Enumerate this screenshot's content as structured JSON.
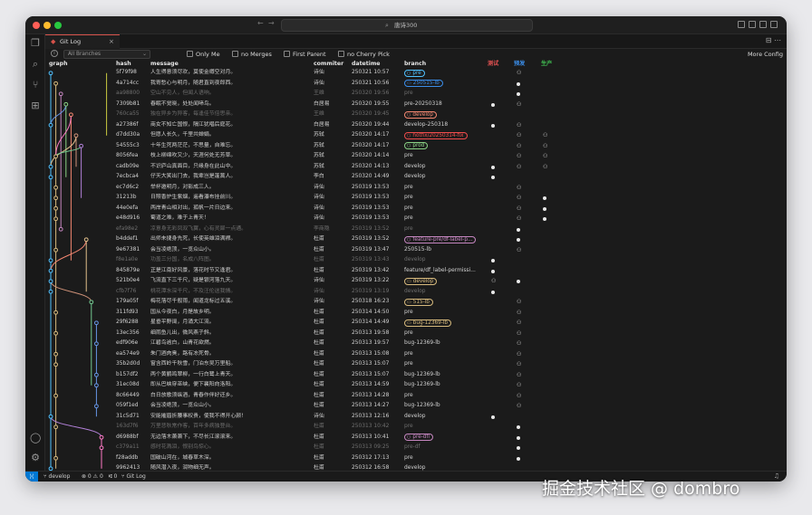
{
  "window": {
    "search_text": "唐诗300"
  },
  "tab": {
    "label": "Git Log",
    "close": "×"
  },
  "toolbar": {
    "branch_placeholder": "All Branches",
    "only_me": "Only Me",
    "no_merges": "no Merges",
    "first_parent": "First Parent",
    "no_cherry_pick": "no Cherry Pick",
    "more_config": "More Config"
  },
  "headers": {
    "graph": "graph",
    "hash": "hash",
    "message": "message",
    "committer": "commiter",
    "datetime": "datetime",
    "branch": "branch",
    "env_test": "测试",
    "env_pre": "预发",
    "env_prod": "生产"
  },
  "colors": {
    "env_test": "#e05151",
    "env_pre": "#3b8eea",
    "env_prod": "#3fb950",
    "graph": [
      "#4fc1ff",
      "#d7ba7d",
      "#c586c0",
      "#89d185",
      "#f48771",
      "#ce9178",
      "#b180d7",
      "#e2c08d",
      "#73c991",
      "#6796e6",
      "#ff79c6",
      "#cbcb41"
    ]
  },
  "commits": [
    {
      "hash": "5f79f98",
      "msg": "人生得意须尽欢，莫使金樽空对月。",
      "who": "诗仙",
      "date": "250321 10:57",
      "branch": "pre",
      "badge": "pre",
      "bcolor": "#4fc1ff",
      "test": "",
      "pre": "person",
      "prod": "",
      "dim": false
    },
    {
      "hash": "4a714cc",
      "msg": "我寄愁心与明月，随君直到夜郎西。",
      "who": "诗仙",
      "date": "250321 10:56",
      "branch": "250515-lb",
      "badge": "tag",
      "bcolor": "#3b8eea",
      "test": "",
      "pre": "dot",
      "prod": "",
      "dim": false
    },
    {
      "hash": "aa98800",
      "msg": "空山不见人，但闻人语响。",
      "who": "王维",
      "date": "250320 19:56",
      "branch": "pre",
      "badge": "",
      "bcolor": "",
      "test": "",
      "pre": "dot",
      "prod": "",
      "dim": true
    },
    {
      "hash": "7309b81",
      "msg": "春眠不觉晓，处处闻啼鸟。",
      "who": "白居易",
      "date": "250320 19:55",
      "branch": "pre-20250318",
      "badge": "",
      "bcolor": "",
      "test": "dot",
      "pre": "person",
      "prod": "",
      "dim": false
    },
    {
      "hash": "760ca55",
      "msg": "独在异乡为异客，每逢佳节倍思亲。",
      "who": "王维",
      "date": "250320 19:45",
      "branch": "develop",
      "badge": "branch",
      "bcolor": "#f48771",
      "test": "",
      "pre": "",
      "prod": "",
      "dim": true
    },
    {
      "hash": "a27386f",
      "msg": "商女不知亡国恨，隔江犹唱后庭花。",
      "who": "白居易",
      "date": "250320 19:44",
      "branch": "develop-250318",
      "badge": "",
      "bcolor": "",
      "test": "dot",
      "pre": "person",
      "prod": "",
      "dim": false
    },
    {
      "hash": "d7dd30a",
      "msg": "但愿人长久，千里共婵娟。",
      "who": "苏轼",
      "date": "250320 14:17",
      "branch": "hotfix/20250314-fix",
      "badge": "branch",
      "bcolor": "#f14c4c",
      "test": "",
      "pre": "person",
      "prod": "person",
      "dim": false
    },
    {
      "hash": "54555c3",
      "msg": "十年生死两茫茫，不思量，自难忘。",
      "who": "苏轼",
      "date": "250320 14:17",
      "branch": "prod",
      "badge": "branch",
      "bcolor": "#89d185",
      "test": "",
      "pre": "person",
      "prod": "person",
      "dim": false
    },
    {
      "hash": "8056fea",
      "msg": "枝上柳绵吹又少，天涯何处无芳草。",
      "who": "苏轼",
      "date": "250320 14:14",
      "branch": "pre",
      "badge": "",
      "bcolor": "",
      "test": "",
      "pre": "person",
      "prod": "person",
      "dim": false
    },
    {
      "hash": "cadb09e",
      "msg": "不识庐山真面目，只缘身在此山中。",
      "who": "苏轼",
      "date": "250320 14:13",
      "branch": "develop",
      "badge": "",
      "bcolor": "",
      "test": "dot",
      "pre": "person",
      "prod": "person",
      "dim": false
    },
    {
      "hash": "7ecbca4",
      "msg": "仔天大笑出门去，我辈岂是蓬蒿人。",
      "who": "李白",
      "date": "250320 14:49",
      "branch": "develop",
      "badge": "",
      "bcolor": "",
      "test": "dot",
      "pre": "",
      "prod": "",
      "dim": false
    },
    {
      "hash": "ec7d6c2",
      "msg": "举杯邀明月，对影成三人。",
      "who": "诗仙",
      "date": "250319 13:53",
      "branch": "pre",
      "badge": "",
      "bcolor": "",
      "test": "",
      "pre": "person",
      "prod": "",
      "dim": false
    },
    {
      "hash": "31213b",
      "msg": "日照香炉生紫烟，遥看瀑布挂前川。",
      "who": "诗仙",
      "date": "250319 13:53",
      "branch": "pre",
      "badge": "",
      "bcolor": "",
      "test": "",
      "pre": "person",
      "prod": "dot",
      "dim": false
    },
    {
      "hash": "44e0efa",
      "msg": "两岸青山相对出，孤帆一片日边来。",
      "who": "诗仙",
      "date": "250319 13:53",
      "branch": "pre",
      "badge": "",
      "bcolor": "",
      "test": "",
      "pre": "person",
      "prod": "dot",
      "dim": false
    },
    {
      "hash": "e48d916",
      "msg": "蜀道之难，难于上青天！",
      "who": "诗仙",
      "date": "250319 13:53",
      "branch": "pre",
      "badge": "",
      "bcolor": "",
      "test": "",
      "pre": "person",
      "prod": "dot",
      "dim": false
    },
    {
      "hash": "efa98e2",
      "msg": "凉意身无彩凤双飞翼，心有灵犀一点通。",
      "who": "李商隐",
      "date": "250319 13:52",
      "branch": "pre",
      "badge": "",
      "bcolor": "",
      "test": "",
      "pre": "dot",
      "prod": "",
      "dim": true
    },
    {
      "hash": "b4ddef1",
      "msg": "出师未捷身先死，长使英雄泪满襟。",
      "who": "杜甫",
      "date": "250319 13:52",
      "branch": "feature-pre/df-label-p...",
      "badge": "branch",
      "bcolor": "#c586c0",
      "test": "",
      "pre": "dot",
      "prod": "",
      "dim": false
    },
    {
      "hash": "9e67381",
      "msg": "会当凌绝顶，一览众山小。",
      "who": "杜甫",
      "date": "250319 13:47",
      "branch": "250515-lb",
      "badge": "",
      "bcolor": "",
      "test": "",
      "pre": "person",
      "prod": "",
      "dim": false
    },
    {
      "hash": "f8e1a0e",
      "msg": "功盖三分国，名成八阵图。",
      "who": "杜甫",
      "date": "250319 13:43",
      "branch": "develop",
      "badge": "",
      "bcolor": "",
      "test": "dot",
      "pre": "",
      "prod": "",
      "dim": true
    },
    {
      "hash": "845879e",
      "msg": "正是江南好风景，落花时节又逢君。",
      "who": "杜甫",
      "date": "250319 13:42",
      "branch": "feature/df_label-permissi...",
      "badge": "",
      "bcolor": "",
      "test": "dot",
      "pre": "",
      "prod": "",
      "dim": false
    },
    {
      "hash": "521b0e4",
      "msg": "飞流直下三千尺，疑是银河落九天。",
      "who": "诗仙",
      "date": "250319 13:22",
      "branch": "develop",
      "badge": "tag",
      "bcolor": "#d7ba7d",
      "test": "person",
      "pre": "dot",
      "prod": "",
      "dim": false
    },
    {
      "hash": "cfb7f76",
      "msg": "桃花潭水深千尺，不及汪伦送我情。",
      "who": "诗仙",
      "date": "250319 13:19",
      "branch": "develop",
      "badge": "",
      "bcolor": "",
      "test": "dot",
      "pre": "",
      "prod": "",
      "dim": true
    },
    {
      "hash": "179a05f",
      "msg": "梅花落尽千般雨，闻道龙标过五溪。",
      "who": "诗仙",
      "date": "250318 16:23",
      "branch": "515-lb",
      "badge": "tag",
      "bcolor": "#d7ba7d",
      "test": "",
      "pre": "person",
      "prod": "",
      "dim": false
    },
    {
      "hash": "311fd93",
      "msg": "国从今夜白，月是故乡明。",
      "who": "杜甫",
      "date": "250314 14:50",
      "branch": "pre",
      "badge": "",
      "bcolor": "",
      "test": "",
      "pre": "person",
      "prod": "",
      "dim": false
    },
    {
      "hash": "29f6288",
      "msg": "星垂平野阔，月涌大江流。",
      "who": "杜甫",
      "date": "250314 14:49",
      "branch": "bug-12369-lb",
      "badge": "tag",
      "bcolor": "#d7ba7d",
      "test": "",
      "pre": "person",
      "prod": "",
      "dim": false
    },
    {
      "hash": "13ec356",
      "msg": "细雨鱼儿出，微风燕子斜。",
      "who": "杜甫",
      "date": "250313 19:58",
      "branch": "pre",
      "badge": "",
      "bcolor": "",
      "test": "",
      "pre": "person",
      "prod": "",
      "dim": false
    },
    {
      "hash": "edf906e",
      "msg": "江碧鸟逾白，山青花欲燃。",
      "who": "杜甫",
      "date": "250313 19:57",
      "branch": "bug-12369-lb",
      "badge": "",
      "bcolor": "",
      "test": "",
      "pre": "person",
      "prod": "",
      "dim": false
    },
    {
      "hash": "ea574e9",
      "msg": "朱门酒肉臭，路有冻死骨。",
      "who": "杜甫",
      "date": "250313 15:08",
      "branch": "pre",
      "badge": "",
      "bcolor": "",
      "test": "",
      "pre": "person",
      "prod": "",
      "dim": false
    },
    {
      "hash": "35b2d0d",
      "msg": "窗含西岭千秋雪，门泊东吴万里船。",
      "who": "杜甫",
      "date": "250313 15:07",
      "branch": "pre",
      "badge": "",
      "bcolor": "",
      "test": "",
      "pre": "person",
      "prod": "",
      "dim": false
    },
    {
      "hash": "b157df2",
      "msg": "两个黄鹂鸣翠柳，一行白鹭上青天。",
      "who": "杜甫",
      "date": "250313 15:07",
      "branch": "bug-12369-lb",
      "badge": "",
      "bcolor": "",
      "test": "",
      "pre": "person",
      "prod": "",
      "dim": false
    },
    {
      "hash": "31ec08d",
      "msg": "即从巴峡穿巫峡，便下襄阳向洛阳。",
      "who": "杜甫",
      "date": "250313 14:59",
      "branch": "bug-12369-lb",
      "badge": "",
      "bcolor": "",
      "test": "",
      "pre": "person",
      "prod": "",
      "dim": false
    },
    {
      "hash": "8c66449",
      "msg": "白日放歌须纵酒，青春作伴好还乡。",
      "who": "杜甫",
      "date": "250313 14:28",
      "branch": "pre",
      "badge": "",
      "bcolor": "",
      "test": "",
      "pre": "person",
      "prod": "",
      "dim": false
    },
    {
      "hash": "059f1ed",
      "msg": "会当凌绝顶，一览众山小。",
      "who": "杜甫",
      "date": "250313 14:27",
      "branch": "bug-12369-lb",
      "badge": "",
      "bcolor": "",
      "test": "",
      "pre": "person",
      "prod": "",
      "dim": false
    },
    {
      "hash": "31c5d71",
      "msg": "安能摧眉折腰事权贵，使我不得开心颜！",
      "who": "诗仙",
      "date": "250313 12:16",
      "branch": "develop",
      "badge": "",
      "bcolor": "",
      "test": "dot",
      "pre": "",
      "prod": "",
      "dim": false
    },
    {
      "hash": "163d7f6",
      "msg": "万里悲秋常作客，百年多病独登台。",
      "who": "杜甫",
      "date": "250313 10:42",
      "branch": "pre",
      "badge": "",
      "bcolor": "",
      "test": "",
      "pre": "dot",
      "prod": "",
      "dim": true
    },
    {
      "hash": "d6988bf",
      "msg": "无边落木萧萧下，不尽长江滚滚来。",
      "who": "杜甫",
      "date": "250313 10:41",
      "branch": "pre-dfl",
      "badge": "branch",
      "bcolor": "#c586c0",
      "test": "",
      "pre": "dot",
      "prod": "",
      "dim": false
    },
    {
      "hash": "c379a11",
      "msg": "感时花溅泪，恨别鸟惊心。",
      "who": "杜甫",
      "date": "250313 09:25",
      "branch": "pre-df",
      "badge": "",
      "bcolor": "",
      "test": "",
      "pre": "dot",
      "prod": "",
      "dim": true
    },
    {
      "hash": "f28addb",
      "msg": "国破山河在，城春草木深。",
      "who": "杜甫",
      "date": "250312 17:13",
      "branch": "pre",
      "badge": "",
      "bcolor": "",
      "test": "",
      "pre": "dot",
      "prod": "",
      "dim": false
    },
    {
      "hash": "9962413",
      "msg": "随风潜入夜，润物细无声。",
      "who": "杜甫",
      "date": "250312 16:58",
      "branch": "develop",
      "badge": "",
      "bcolor": "",
      "test": "",
      "pre": "",
      "prod": "",
      "dim": false
    }
  ],
  "statusbar": {
    "branch": "develop",
    "problems": "⊗ 0 ⚠ 0",
    "ports": "⑆ 0",
    "gitlog": "Git Log"
  },
  "watermark": {
    "text": "掘金技术社区 @ dombro"
  }
}
